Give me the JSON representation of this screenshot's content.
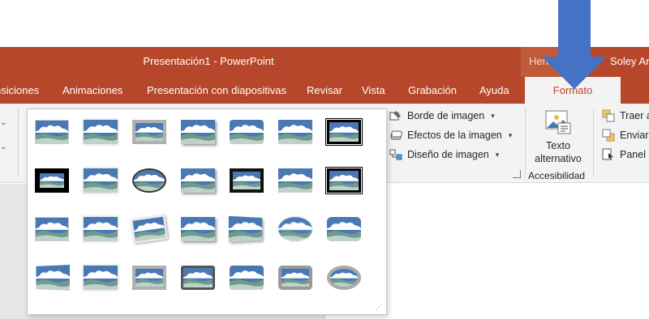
{
  "window": {
    "title": "Presentación1  -  PowerPoint",
    "context_tab_label": "Herra",
    "user": "Soley Ar"
  },
  "tabs": [
    {
      "label": "nsiciones"
    },
    {
      "label": "Animaciones"
    },
    {
      "label": "Presentación con diapositivas"
    },
    {
      "label": "Revisar"
    },
    {
      "label": "Vista"
    },
    {
      "label": "Grabación"
    },
    {
      "label": "Ayuda"
    },
    {
      "label": "Formato",
      "active": true
    }
  ],
  "ribbon": {
    "picture_border": "Borde de imagen",
    "picture_effects": "Efectos de la imagen",
    "picture_layout": "Diseño de imagen",
    "alt_text_line1": "Texto",
    "alt_text_line2": "alternativo",
    "accessibility_group": "Accesibilidad",
    "bring_forward": "Traer a",
    "send_backward": "Enviar",
    "selection_pane": "Panel d"
  },
  "gallery": {
    "rows": 4,
    "columns": 7,
    "styles": [
      "Simple Frame, White",
      "Soft Edge Rectangle",
      "Simple Frame, Gray",
      "Drop Shadow Rectangle",
      "Reflected Rounded Rectangle",
      "Soft Edge Rectangle 2",
      "Double Frame, Black",
      "Thick Matte, Black",
      "Simple Frame, Black",
      "Oval Shadow",
      "Compound Frame, Black",
      "Thick Frame, Black",
      "Center Shadow Rectangle",
      "Rounded Diagonal Corner, White",
      "Snip Diagonal Corner, White",
      "Moderate Frame, White",
      "Rotated, White",
      "Perspective Shadow, White",
      "Relaxed Perspective, White",
      "Soft Edge Oval",
      "Bevel Rectangle",
      "Bevel Perspective",
      "Reflected Bevel",
      "Simple Frame, Rounded",
      "Metal Frame",
      "Reflected Perspective Right",
      "Metal Rounded Rectangle",
      "Metal Oval"
    ]
  },
  "colors": {
    "ribbon_red": "#b7472a",
    "arrow_blue": "#4472c4",
    "sky_blue": "#4a78b5",
    "grass_green": "#6f9b8a"
  }
}
